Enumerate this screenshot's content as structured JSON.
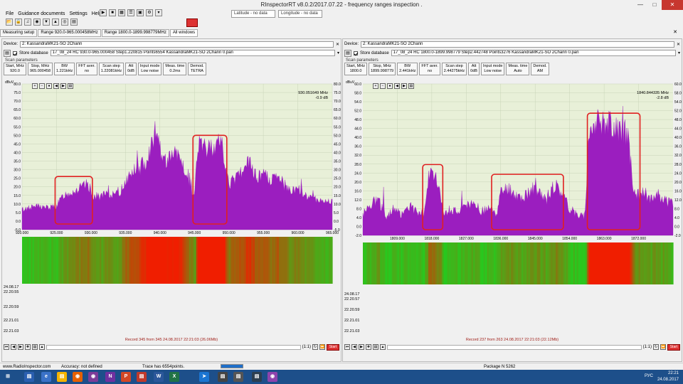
{
  "window": {
    "title": "RInspectorRT v8.0.2/2017.07.22 - frequency ranges inspection ."
  },
  "menu": [
    "File",
    "Guidance documents",
    "Settings",
    "Help"
  ],
  "fields": {
    "latitude_placeholder": "Latitude - no data",
    "longitude_placeholder": "Longitude - no data"
  },
  "tabs": [
    "Measuring setup",
    "Range 920.0-965.000458MHz",
    "Range 1800.0-1899.998779MHz",
    "All windows"
  ],
  "panels": [
    {
      "device_label": "Device:",
      "device": "2: KassandraMK21-SO 2Chann",
      "store_label": "Store database",
      "file": "17_08_24 RC 930.0-965.000458 Step1.220815 Points6554 KassandraMK21-SO 2Chann 0.pan",
      "scan_label": "Scan parameters",
      "params": [
        {
          "k": "Start, MHz",
          "v": "920.0"
        },
        {
          "k": "Stop, MHz",
          "v": "965.000458"
        },
        {
          "k": "BW",
          "v": "1.221kHz"
        },
        {
          "k": "FFT aver.",
          "v": "no"
        },
        {
          "k": "Scan step",
          "v": "1.22081kHz"
        },
        {
          "k": "Att",
          "v": "0dB"
        },
        {
          "k": "Input mode",
          "v": "Low noise"
        },
        {
          "k": "Meas. time",
          "v": "0.2ms"
        },
        {
          "k": "Demod.",
          "v": "TETRA"
        }
      ],
      "unit": "dBuV",
      "readout_freq": "930.051649 MHz",
      "readout_level": "-0.9 dB",
      "wf_date": "24.08.17",
      "wf_times": [
        "22.20.55",
        "22.20.59",
        "22.21.01",
        "22.21.03"
      ],
      "record": "Record 345 from 345 24.08.2017 22:21:03 (26.06Mb)",
      "mode": "(1:1)",
      "start": "Start"
    },
    {
      "device_label": "Device:",
      "device": "2: KassandraMK21-SO 2Chann",
      "store_label": "Store database",
      "file": "17_08_24 RC 1800.0-1899.998779 Step2.442748 Points3276 KassandraMK21-SO 2Chann 0.pan",
      "scan_label": "Scan parameters",
      "params": [
        {
          "k": "Start, MHz",
          "v": "1800.0"
        },
        {
          "k": "Stop, MHz",
          "v": "1899.998779"
        },
        {
          "k": "BW",
          "v": "2.441kHz"
        },
        {
          "k": "FFT aver.",
          "v": "no"
        },
        {
          "k": "Scan step",
          "v": "2.44275kHz"
        },
        {
          "k": "Att",
          "v": "0dB"
        },
        {
          "k": "Input mode",
          "v": "Low noise"
        },
        {
          "k": "Meas. time",
          "v": "Auto"
        },
        {
          "k": "Demod.",
          "v": "AM"
        }
      ],
      "unit": "dBuV",
      "readout_freq": "1840.844335 MHz",
      "readout_level": "-2.8 dB",
      "wf_date": "24.08.17",
      "wf_times": [
        "22.20.57",
        "22.20.59",
        "22.21.01",
        "22.21.03"
      ],
      "record": "Record 237 from 263 24.08.2017 22:21:03 (22.12Mb)",
      "mode": "(1:1)",
      "start": "Start"
    }
  ],
  "chart_data": [
    {
      "type": "area",
      "title": "",
      "color": "#9b1ebf",
      "xlabel": "",
      "ylabel": "dBuV",
      "xlim": [
        920,
        965
      ],
      "ylim": [
        -5,
        80
      ],
      "x_ticks": [
        "920.000",
        "925.000",
        "930.000",
        "935.000",
        "940.000",
        "945.000",
        "950.000",
        "955.000",
        "960.000",
        "965.000"
      ],
      "y_ticks": [
        "80.0",
        "75.0",
        "70.0",
        "65.0",
        "60.0",
        "55.0",
        "50.0",
        "45.0",
        "40.0",
        "35.0",
        "30.0",
        "25.0",
        "20.0",
        "15.0",
        "10.0",
        "5.0",
        "0.0",
        "-5.0"
      ],
      "x": [
        920,
        922,
        924,
        925,
        926,
        928,
        929.5,
        930.5,
        932,
        933,
        934,
        935,
        936,
        937,
        938,
        939,
        939.5,
        940,
        941,
        942,
        943,
        944,
        945,
        945.5,
        946,
        947,
        948,
        949,
        949.5,
        950,
        951,
        952,
        953,
        954,
        955,
        956,
        957,
        958,
        959,
        960,
        961,
        962,
        963,
        964,
        965
      ],
      "values": [
        6,
        8,
        7,
        8,
        14,
        17,
        20,
        13,
        14,
        15,
        14,
        22,
        27,
        29,
        33,
        45,
        52,
        40,
        33,
        37,
        34,
        20,
        14,
        44,
        40,
        40,
        42,
        44,
        28,
        20,
        24,
        28,
        32,
        24,
        26,
        22,
        24,
        20,
        16,
        18,
        14,
        12,
        12,
        10,
        11
      ],
      "highlight_ranges": [
        [
          925,
          930
        ],
        [
          945,
          949.5
        ]
      ]
    },
    {
      "type": "area",
      "title": "",
      "color": "#9b1ebf",
      "xlabel": "",
      "ylabel": "dBuV",
      "xlim": [
        1800,
        1881
      ],
      "ylim": [
        -2,
        60
      ],
      "x_ticks": [
        "1809.000",
        "1818.000",
        "1827.000",
        "1836.000",
        "1845.000",
        "1854.000",
        "1863.000",
        "1872.000"
      ],
      "y_ticks": [
        "60.0",
        "58.0",
        "54.0",
        "52.0",
        "48.0",
        "44.0",
        "40.0",
        "36.0",
        "32.0",
        "28.0",
        "24.0",
        "20.0",
        "16.0",
        "12.0",
        "8.0",
        "4.0",
        "0.0",
        "-2.0"
      ],
      "x": [
        1800,
        1802,
        1804,
        1806,
        1808,
        1810,
        1812,
        1814,
        1816,
        1817,
        1818,
        1820,
        1821,
        1823,
        1825,
        1827,
        1829,
        1831,
        1833,
        1835,
        1836,
        1838,
        1840,
        1842,
        1844,
        1846,
        1848,
        1850,
        1852,
        1854,
        1856,
        1858,
        1859,
        1861,
        1863,
        1865,
        1867,
        1869,
        1871,
        1873,
        1875,
        1877,
        1879,
        1881
      ],
      "values": [
        6,
        10,
        12,
        5,
        8,
        6,
        9,
        7,
        6,
        20,
        21,
        18,
        6,
        8,
        7,
        9,
        10,
        7,
        8,
        6,
        14,
        16,
        13,
        12,
        16,
        14,
        12,
        17,
        15,
        8,
        6,
        5,
        40,
        41,
        42,
        40,
        38,
        38,
        13,
        15,
        12,
        14,
        11,
        10
      ],
      "highlight_ranges": [
        [
          1816,
          1820.5
        ],
        [
          1834,
          1852
        ],
        [
          1859,
          1872
        ]
      ]
    }
  ],
  "status": {
    "site": "www.RadioInspector.com",
    "accuracy": "Accuracy: not defined",
    "trace": "Trace has 6554points.",
    "package": "Package N 5262"
  },
  "taskbar": {
    "lang": "РУС",
    "time": "22:21",
    "date": "24.08.2017"
  }
}
